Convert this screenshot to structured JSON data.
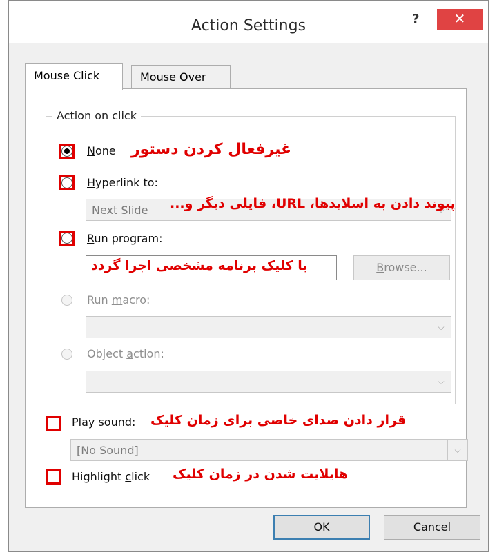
{
  "window": {
    "title": "Action Settings",
    "help_label": "?",
    "close_label": "✕"
  },
  "tabs": [
    {
      "label": "Mouse Click"
    },
    {
      "label": "Mouse Over"
    }
  ],
  "group": {
    "legend": "Action on click"
  },
  "options": {
    "none": {
      "mnemonic": "N",
      "rest": "one",
      "annotation": "غیرفعال کردن دستور"
    },
    "hyperlink": {
      "mnemonic": "H",
      "rest": "yperlink to:",
      "value": "Next Slide",
      "annotation": "پیوند دادن به اسلایدها، URL، فایلی دیگر و..."
    },
    "run_program": {
      "mnemonic": "R",
      "rest": "un program:",
      "annotation": "با کلیک برنامه مشخصی اجرا گردد",
      "browse_pre": "",
      "browse_mn": "B",
      "browse_rest": "rowse..."
    },
    "run_macro": {
      "pre": "Run ",
      "mnemonic": "m",
      "rest": "acro:"
    },
    "object_action": {
      "pre": "Object ",
      "mnemonic": "a",
      "rest": "ction:"
    }
  },
  "sound": {
    "mnemonic": "P",
    "rest": "lay sound:",
    "value": "[No Sound]",
    "annotation": "قرار دادن صدای خاصی برای زمان کلیک"
  },
  "highlight": {
    "pre": "Highlight ",
    "mnemonic": "c",
    "rest": "lick",
    "annotation": "هایلایت شدن در زمان کلیک"
  },
  "footer": {
    "ok": "OK",
    "cancel": "Cancel"
  },
  "icons": {
    "dropdown": "chevron-down-icon",
    "radio": "radio-icon"
  },
  "colors": {
    "annotation": "#e00000",
    "close": "#e04343",
    "default_button_border": "#3c7fb1"
  }
}
